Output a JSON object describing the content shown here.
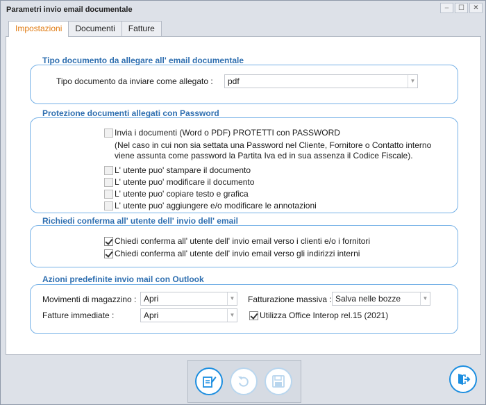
{
  "window": {
    "title": "Parametri invio email documentale"
  },
  "window_buttons": [
    "–",
    "☐",
    "✕"
  ],
  "tabs": [
    {
      "label": "Impostazioni",
      "active": true
    },
    {
      "label": "Documenti",
      "active": false
    },
    {
      "label": "Fatture",
      "active": false
    }
  ],
  "sec1": {
    "title": "Tipo documento da allegare all' email documentale",
    "label": "Tipo documento da inviare come allegato :",
    "value": "pdf"
  },
  "sec2": {
    "title": "Protezione documenti allegati con Password",
    "protect_label": "Invia i documenti (Word o PDF) PROTETTI con PASSWORD",
    "note_line1": "(Nel caso in cui non sia settata una Password nel Cliente, Fornitore o Contatto interno",
    "note_line2": "viene assunta come password la Partita Iva ed in sua assenza il Codice Fiscale).",
    "opt_print": "L' utente puo' stampare il documento",
    "opt_edit": "L' utente puo' modificare il documento",
    "opt_copy": "L' utente puo' copiare testo e grafica",
    "opt_annot": "L' utente puo' aggiungere e/o modificare le annotazioni"
  },
  "sec3": {
    "title": "Richiedi conferma all' utente dell' invio dell' email",
    "opt_clients": "Chiedi conferma all' utente dell' invio email verso i clienti e/o i fornitori",
    "opt_internal": "Chiedi conferma all' utente dell' invio email verso gli indirizzi interni"
  },
  "sec4": {
    "title": "Azioni predefinite invio mail con Outlook",
    "mov_label": "Movimenti di magazzino :",
    "mov_value": "Apri",
    "fatt_label": "Fatture immediate :",
    "fatt_value": "Apri",
    "massiva_label": "Fatturazione massiva :",
    "massiva_value": "Salva nelle bozze",
    "interop_label": "Utilizza Office Interop rel.15 (2021)"
  },
  "colors": {
    "accent": "#1c8ee0",
    "section_title": "#2f6fb0",
    "active_tab": "#e07b12"
  }
}
